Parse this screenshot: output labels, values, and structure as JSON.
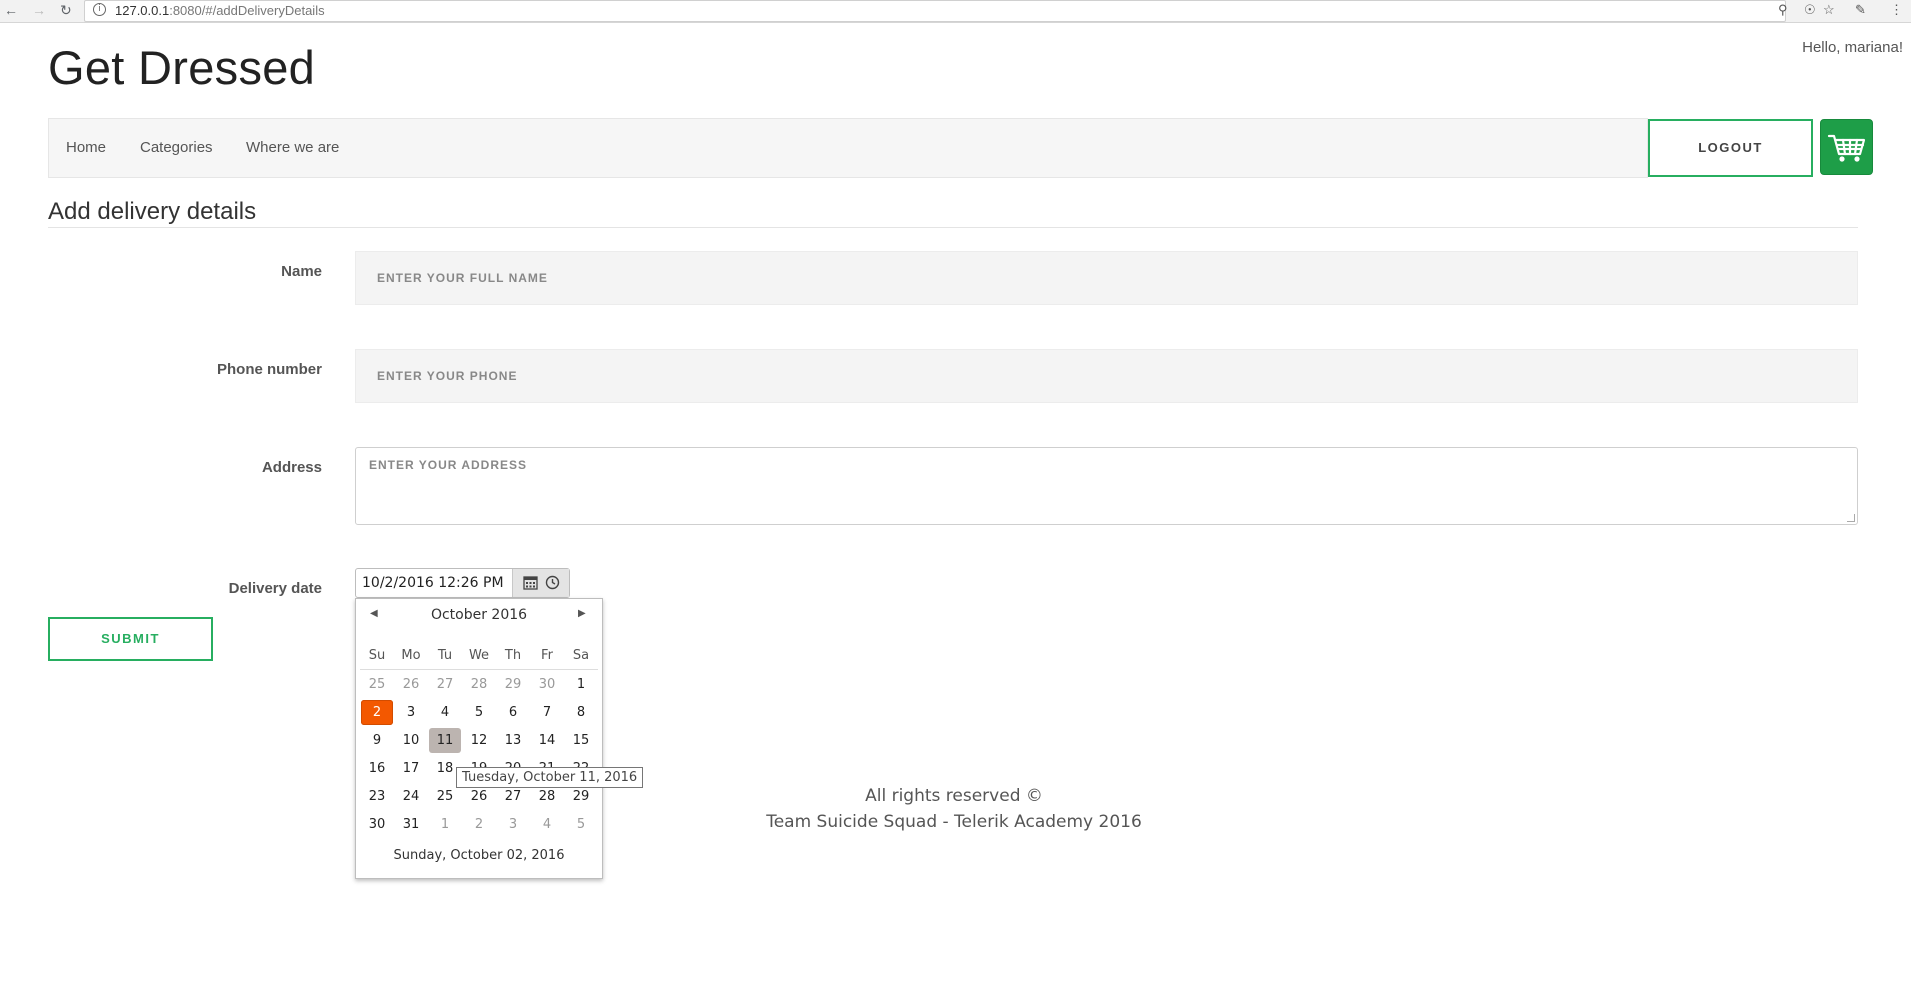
{
  "browser": {
    "url_host": "127.0.0.1",
    "url_rest": ":8080/#/addDeliveryDetails"
  },
  "header": {
    "brand": "Get Dressed",
    "greeting": "Hello, mariana!"
  },
  "nav": {
    "items": [
      "Home",
      "Categories",
      "Where we are"
    ],
    "logout_label": "LOGOUT",
    "cart_icon": "shopping-cart-icon"
  },
  "form": {
    "heading": "Add delivery details",
    "name_label": "Name",
    "name_placeholder": "ENTER YOUR FULL NAME",
    "phone_label": "Phone number",
    "phone_placeholder": "ENTER YOUR PHONE",
    "address_label": "Address",
    "address_placeholder": "ENTER YOUR ADDRESS",
    "date_label": "Delivery date",
    "date_value": "10/2/2016 12:26 PM",
    "submit_label": "SUBMIT"
  },
  "calendar": {
    "month_title": "October 2016",
    "weekdays": [
      "Su",
      "Mo",
      "Tu",
      "We",
      "Th",
      "Fr",
      "Sa"
    ],
    "weeks": [
      [
        "25",
        "26",
        "27",
        "28",
        "29",
        "30",
        "1"
      ],
      [
        "2",
        "3",
        "4",
        "5",
        "6",
        "7",
        "8"
      ],
      [
        "9",
        "10",
        "11",
        "12",
        "13",
        "14",
        "15"
      ],
      [
        "16",
        "17",
        "18",
        "19",
        "20",
        "21",
        "22"
      ],
      [
        "23",
        "24",
        "25",
        "26",
        "27",
        "28",
        "29"
      ],
      [
        "30",
        "31",
        "1",
        "2",
        "3",
        "4",
        "5"
      ]
    ],
    "selected_day": "2",
    "hovered_day": "11",
    "footer": "Sunday, October 02, 2016",
    "tooltip": "Tuesday, October 11, 2016",
    "selected_color": "#f35800"
  },
  "footer": {
    "line1": "All rights reserved ©",
    "line2": "Team Suicide Squad - Telerik Academy 2016"
  },
  "colors": {
    "accent": "#27ae60",
    "cart": "#1e9e48"
  }
}
